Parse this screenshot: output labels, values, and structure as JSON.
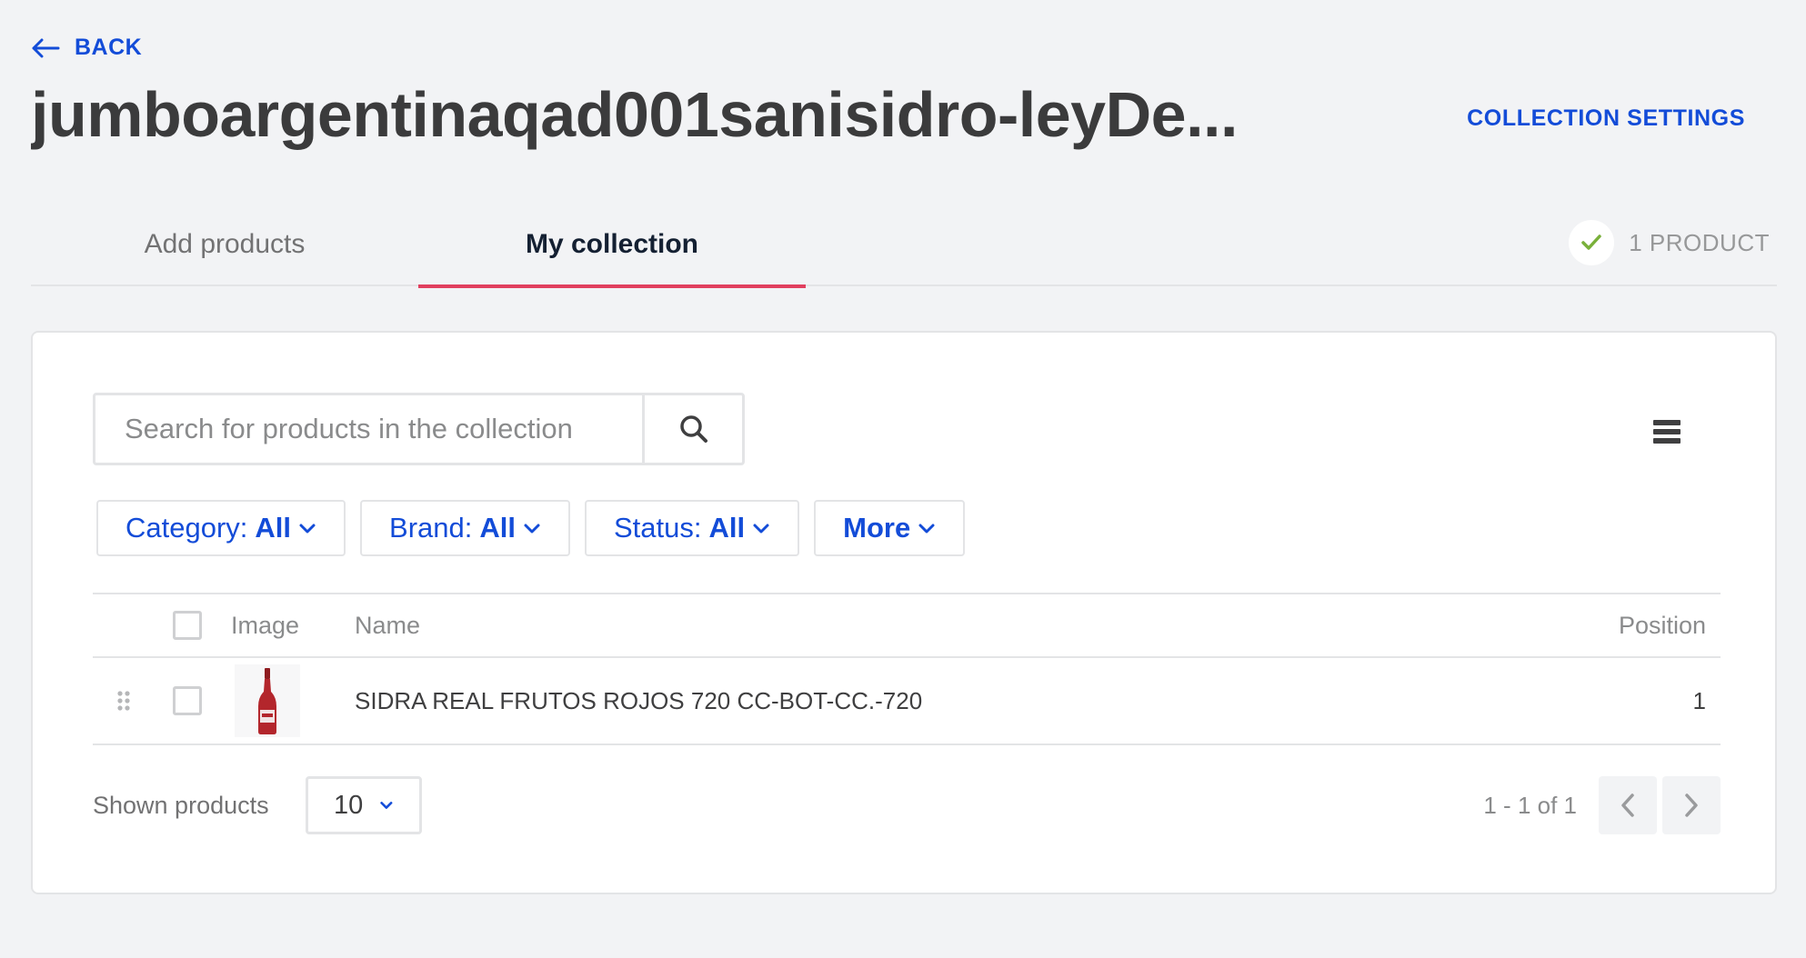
{
  "header": {
    "back_label": "BACK",
    "title": "jumboargentinaqad001sanisidro-leyDe...",
    "settings_label": "COLLECTION SETTINGS"
  },
  "tabs": [
    {
      "label": "Add products",
      "active": false
    },
    {
      "label": "My collection",
      "active": true
    }
  ],
  "product_count": {
    "label": "1 PRODUCT",
    "icon": "check-icon",
    "color": "#79b03a"
  },
  "search": {
    "placeholder": "Search for products in the collection",
    "value": ""
  },
  "filters": [
    {
      "label": "Category:",
      "value": "All"
    },
    {
      "label": "Brand:",
      "value": "All"
    },
    {
      "label": "Status:",
      "value": "All"
    },
    {
      "label": "",
      "value": "More"
    }
  ],
  "table": {
    "columns": {
      "image": "Image",
      "name": "Name",
      "position": "Position"
    },
    "rows": [
      {
        "name": "SIDRA REAL FRUTOS ROJOS 720 CC-BOT-CC.-720",
        "position": "1",
        "image": "red-bottle"
      }
    ]
  },
  "pagination": {
    "shown_label": "Shown products",
    "page_size": "10",
    "range": "1 - 1 of 1"
  },
  "colors": {
    "accent": "#134cd8",
    "active_tab_underline": "#e13f5e",
    "background": "#f2f3f5"
  }
}
